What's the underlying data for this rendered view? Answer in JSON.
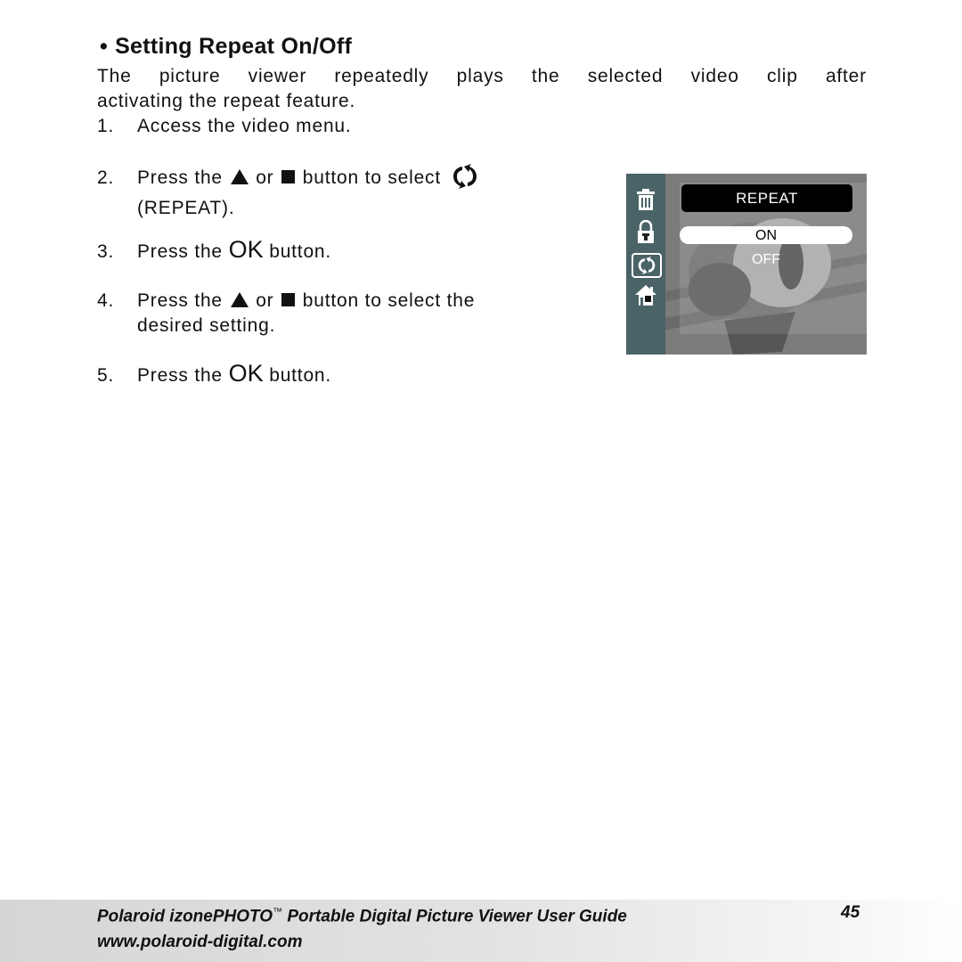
{
  "heading": {
    "bullet": "•",
    "title": "Setting Repeat On/Off"
  },
  "intro": {
    "line1_words": [
      "The",
      "picture",
      "viewer",
      "repeatedly",
      "plays",
      "the",
      "selected",
      "video",
      "clip",
      "after"
    ],
    "line2": "activating the repeat feature."
  },
  "steps": [
    {
      "num": "1.",
      "text": "Access the video menu."
    },
    {
      "num": "2.",
      "pre": "Press the",
      "or": "or",
      "post": "button to select",
      "cont": "(REPEAT).",
      "icons": [
        "up-triangle-icon",
        "square-button-icon",
        "repeat-icon"
      ]
    },
    {
      "num": "3.",
      "pre": "Press the",
      "ok": "OK",
      "post": "button."
    },
    {
      "num": "4.",
      "pre": "Press the",
      "or": "or",
      "post": "button to select the",
      "cont": "desired setting.",
      "icons": [
        "up-triangle-icon",
        "square-button-icon"
      ]
    },
    {
      "num": "5.",
      "pre": "Press the",
      "ok": "OK",
      "post": "button."
    }
  ],
  "screen": {
    "sidebar_icons": [
      "trash-icon",
      "lock-icon",
      "repeat-icon",
      "home-icon"
    ],
    "selected_sidebar_icon": "repeat-icon",
    "menu_title": "REPEAT",
    "options": [
      "ON",
      "OFF"
    ],
    "selected_option": "ON",
    "colors": {
      "sidebar": "#4a6366",
      "title_bg": "#000000",
      "highlight": "#ffffff"
    }
  },
  "footer": {
    "title_pre": "Polaroid izonePHOTO",
    "trademark": "™",
    "title_post": " Portable Digital Picture Viewer User Guide",
    "url": "www.polaroid-digital.com",
    "page_number": "45"
  }
}
